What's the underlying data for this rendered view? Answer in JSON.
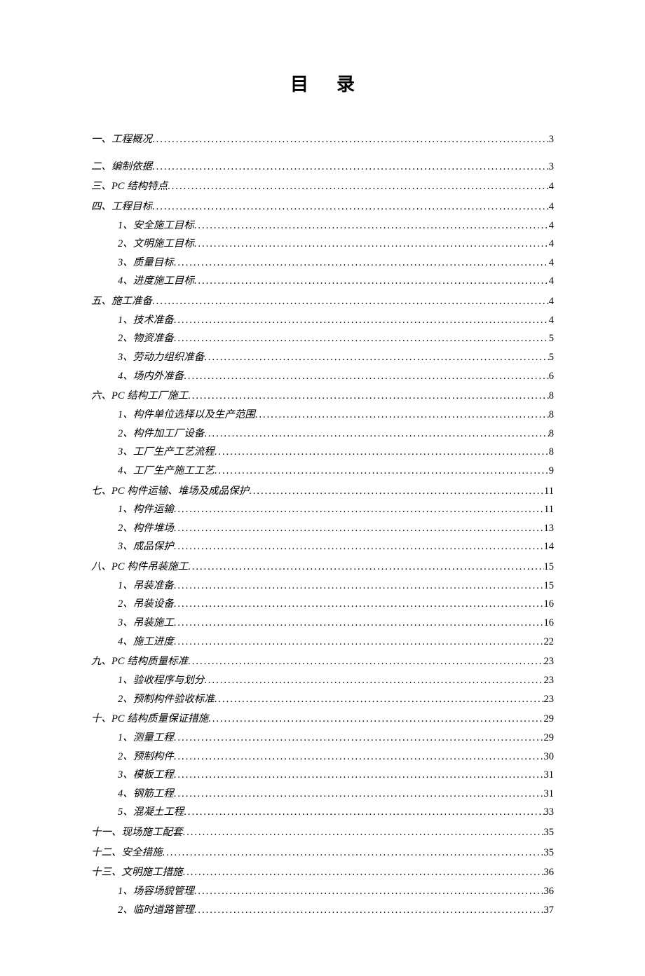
{
  "title": "目录",
  "entries": [
    {
      "level": 1,
      "label": "一、工程概况",
      "page": "3",
      "italic": true,
      "firstGap": true
    },
    {
      "level": 1,
      "label": "二、编制依据",
      "page": "3",
      "italic": true
    },
    {
      "level": 1,
      "label": "三、PC 结构特点",
      "page": "4",
      "italic": true
    },
    {
      "level": 1,
      "label": "四、工程目标",
      "page": "4",
      "italic": true
    },
    {
      "level": 2,
      "label": "1、安全施工目标",
      "page": "4",
      "italic": true
    },
    {
      "level": 2,
      "label": "2、文明施工目标",
      "page": "4",
      "italic": true
    },
    {
      "level": 2,
      "label": "3、质量目标",
      "page": "4",
      "italic": true
    },
    {
      "level": 2,
      "label": "4、进度施工目标",
      "page": "4",
      "italic": true
    },
    {
      "level": 1,
      "label": "五、施工准备",
      "page": "4",
      "italic": true
    },
    {
      "level": 2,
      "label": "1、技术准备",
      "page": "4",
      "italic": true
    },
    {
      "level": 2,
      "label": "2、物资准备",
      "page": "5",
      "italic": true
    },
    {
      "level": 2,
      "label": "3、劳动力组织准备",
      "page": "5",
      "italic": true
    },
    {
      "level": 2,
      "label": "4、场内外准备",
      "page": "6",
      "italic": true
    },
    {
      "level": 1,
      "label": "六、PC 结构工厂施工",
      "page": "8",
      "italic": true
    },
    {
      "level": 2,
      "label": "1、构件单位选择以及生产范围",
      "page": "8",
      "italic": true
    },
    {
      "level": 2,
      "label": "2、构件加工厂设备",
      "page": "8",
      "italic": true
    },
    {
      "level": 2,
      "label": "3、工厂生产工艺流程",
      "page": "8",
      "italic": true
    },
    {
      "level": 2,
      "label": "4、工厂生产施工工艺",
      "page": "9",
      "italic": true
    },
    {
      "level": 1,
      "label": "七、PC 构件运输、堆场及成品保护",
      "page": "11",
      "italic": true
    },
    {
      "level": 2,
      "label": "1、构件运输",
      "page": "11",
      "italic": true
    },
    {
      "level": 2,
      "label": "2、构件堆场",
      "page": "13",
      "italic": true
    },
    {
      "level": 2,
      "label": "3、成品保护",
      "page": "14",
      "italic": true
    },
    {
      "level": 1,
      "label": "八、PC 构件吊装施工",
      "page": "15",
      "italic": true
    },
    {
      "level": 2,
      "label": "1、吊装准备",
      "page": "15",
      "italic": true
    },
    {
      "level": 2,
      "label": "2、吊装设备",
      "page": "16",
      "italic": true
    },
    {
      "level": 2,
      "label": "3、吊装施工",
      "page": "16",
      "italic": true
    },
    {
      "level": 2,
      "label": "4、施工进度",
      "page": "22",
      "italic": true
    },
    {
      "level": 1,
      "label": "九、PC 结构质量标准",
      "page": "23",
      "italic": true
    },
    {
      "level": 2,
      "label": "1、验收程序与划分",
      "page": "23",
      "italic": true
    },
    {
      "level": 2,
      "label": "2、预制构件验收标准",
      "page": "23",
      "italic": true
    },
    {
      "level": 1,
      "label": "十、PC 结构质量保证措施",
      "page": "29",
      "italic": true
    },
    {
      "level": 2,
      "label": "1、测量工程",
      "page": "29",
      "italic": true
    },
    {
      "level": 2,
      "label": "2、预制构件",
      "page": "30",
      "italic": true
    },
    {
      "level": 2,
      "label": "3、模板工程",
      "page": "31",
      "italic": true
    },
    {
      "level": 2,
      "label": "4、钢筋工程",
      "page": "31",
      "italic": true
    },
    {
      "level": 2,
      "label": "5、混凝土工程",
      "page": "33",
      "italic": true
    },
    {
      "level": 1,
      "label": "十一、现场施工配套",
      "page": "35",
      "italic": true
    },
    {
      "level": 1,
      "label": "十二、安全措施",
      "page": "35",
      "italic": true
    },
    {
      "level": 1,
      "label": "十三、文明施工措施",
      "page": "36",
      "italic": true
    },
    {
      "level": 2,
      "label": "1、场容场貌管理",
      "page": "36",
      "italic": true
    },
    {
      "level": 2,
      "label": "2、临时道路管理",
      "page": "37",
      "italic": true
    }
  ]
}
